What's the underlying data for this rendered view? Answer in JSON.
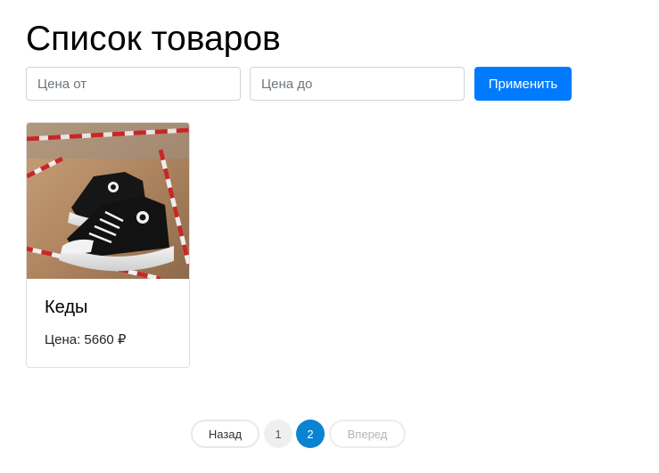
{
  "page": {
    "title": "Список товаров"
  },
  "filters": {
    "price_from_placeholder": "Цена от",
    "price_to_placeholder": "Цена до",
    "apply_label": "Применить",
    "accent_color": "#007bff"
  },
  "products": [
    {
      "name": "Кеды",
      "price_text": "Цена: 5660 ₽",
      "image": "sneakers-photo"
    }
  ],
  "pagination": {
    "prev_label": "Назад",
    "pages": [
      "1",
      "2"
    ],
    "current": "2",
    "next_label": "Вперед",
    "next_disabled": true,
    "active_color": "#0a84d0"
  }
}
